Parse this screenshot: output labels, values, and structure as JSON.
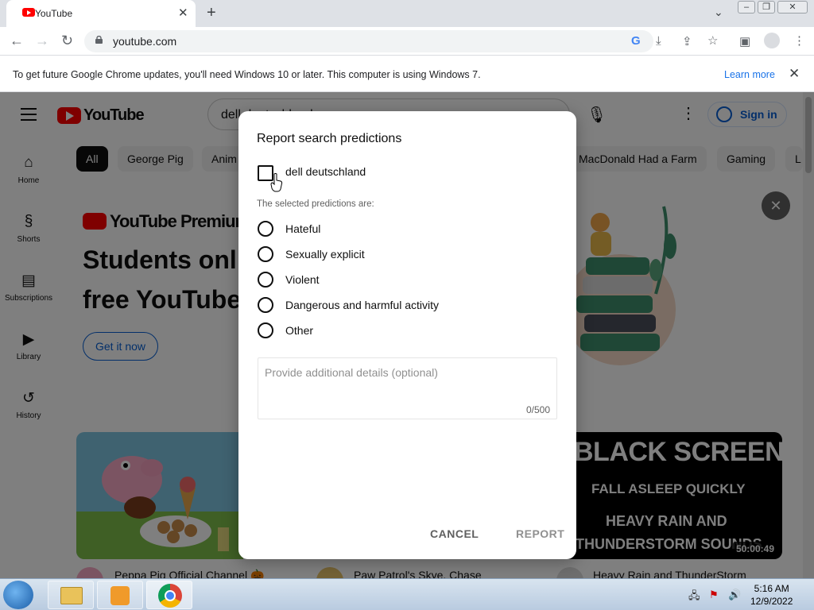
{
  "browser": {
    "tab_title": "YouTube",
    "tab_close": "✕",
    "new_tab": "+",
    "url": "youtube.com",
    "infobar": {
      "message": "To get future Google Chrome updates, you'll need Windows 10 or later. This computer is using Windows 7.",
      "learn_more": "Learn more",
      "close": "✕"
    }
  },
  "youtube": {
    "logo": "YouTube",
    "search_value": "dell deutschland",
    "sign_in": "Sign in",
    "sidebar": [
      {
        "label": "Home",
        "icon": "home-icon"
      },
      {
        "label": "Shorts",
        "icon": "shorts-icon"
      },
      {
        "label": "Subscriptions",
        "icon": "subscriptions-icon"
      },
      {
        "label": "Library",
        "icon": "library-icon"
      },
      {
        "label": "History",
        "icon": "history-icon"
      }
    ],
    "chips": [
      "All",
      "George Pig",
      "Anim",
      "MacDonald Had a Farm",
      "Gaming",
      "L"
    ],
    "premium": {
      "logo": "YouTube Premium",
      "headline_1": "Students onl",
      "headline_2": "free YouTube",
      "cta": "Get it now"
    },
    "videos": [
      {
        "title": "Peppa Pig Official Channel 🎃"
      },
      {
        "title": "Paw Patrol's Skye, Chase"
      },
      {
        "title": "Heavy Rain and ThunderStorm",
        "thumb_text": [
          "BLACK SCREEN",
          "FALL ASLEEP QUICKLY",
          "HEAVY RAIN AND",
          "THUNDERSTORM SOUNDS"
        ],
        "duration": "50:00:49"
      }
    ]
  },
  "dialog": {
    "title": "Report search predictions",
    "prediction": "dell deutschland",
    "prediction_checked": false,
    "subtitle": "The selected predictions are:",
    "options": [
      "Hateful",
      "Sexually explicit",
      "Violent",
      "Dangerous and harmful activity",
      "Other"
    ],
    "details_placeholder": "Provide additional details (optional)",
    "char_count": "0/500",
    "cancel": "CANCEL",
    "report": "REPORT"
  },
  "taskbar": {
    "time": "5:16 AM",
    "date": "12/9/2022"
  },
  "colors": {
    "youtube_red": "#ff0000",
    "link_blue": "#065fd4",
    "chrome_blue": "#1a73e8"
  }
}
